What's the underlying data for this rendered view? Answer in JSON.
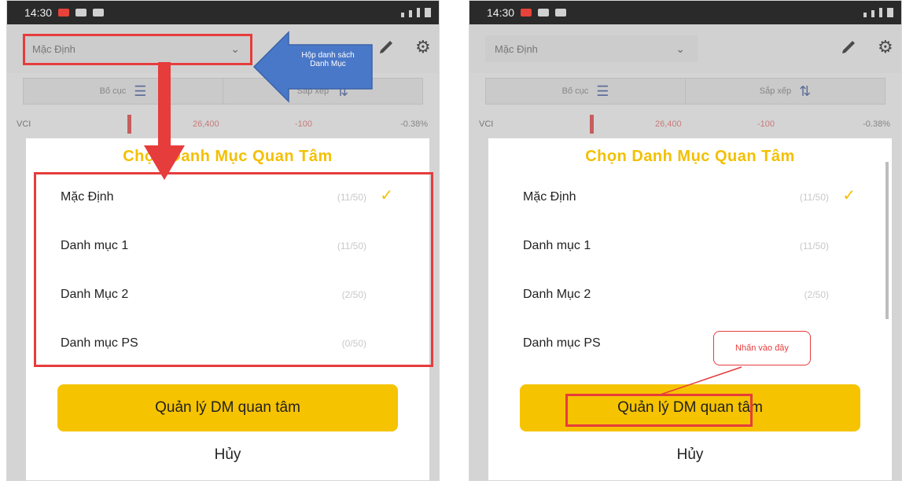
{
  "left": {
    "status": {
      "time": "14:30"
    },
    "header": {
      "list_selected": "Mặc Định"
    },
    "segments": [
      {
        "label": "Bố cục"
      },
      {
        "label": "Sắp xếp"
      }
    ],
    "quote": {
      "symbol": "VCI",
      "price": "26,400",
      "change": "-100",
      "percent": "-0.38%"
    },
    "sheet": {
      "title": "Chọn Danh Mục Quan Tâm",
      "items": [
        {
          "name": "Mặc Định",
          "count": "(11/50)",
          "selected": true
        },
        {
          "name": "Danh mục 1",
          "count": "(11/50)",
          "selected": false
        },
        {
          "name": "Danh Mục 2",
          "count": "(2/50)",
          "selected": false
        },
        {
          "name": "Danh mục PS",
          "count": "(0/50)",
          "selected": false
        }
      ],
      "manage_label": "Quản lý DM quan tâm",
      "cancel_label": "Hủy"
    },
    "annotation": {
      "text": "Hộp danh sách Danh Mục"
    }
  },
  "right": {
    "status": {
      "time": "14:30"
    },
    "header": {
      "list_selected": "Mặc Định"
    },
    "segments": [
      {
        "label": "Bố cục"
      },
      {
        "label": "Sắp xếp"
      }
    ],
    "quote": {
      "symbol": "VCI",
      "price": "26,400",
      "change": "-100",
      "percent": "-0.38%"
    },
    "sheet": {
      "title": "Chọn Danh Mục Quan Tâm",
      "items": [
        {
          "name": "Mặc Định",
          "count": "(11/50)",
          "selected": true
        },
        {
          "name": "Danh mục 1",
          "count": "(11/50)",
          "selected": false
        },
        {
          "name": "Danh Mục 2",
          "count": "(2/50)",
          "selected": false
        },
        {
          "name": "Danh mục PS",
          "count": "",
          "selected": false
        }
      ],
      "manage_label": "Quản lý DM quan tâm",
      "cancel_label": "Hủy"
    },
    "annotation": {
      "text": "Nhấn vào đây"
    }
  },
  "colors": {
    "accent_yellow": "#f6c300",
    "annotation_red": "#e63c3c",
    "annotation_blue": "#4a78c8"
  },
  "icons": [
    "pencil-icon",
    "gear-icon",
    "layout-list-icon",
    "sort-icon",
    "chevron-down-icon",
    "check-icon"
  ]
}
